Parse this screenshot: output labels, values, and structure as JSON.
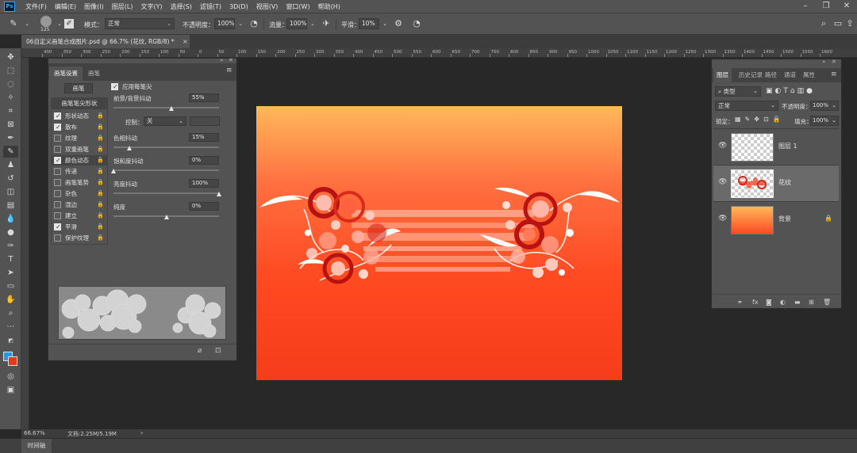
{
  "menubar": {
    "logo": "Ps",
    "items": [
      "文件(F)",
      "编辑(E)",
      "图像(I)",
      "图层(L)",
      "文字(Y)",
      "选择(S)",
      "滤镜(T)",
      "3D(D)",
      "视图(V)",
      "窗口(W)",
      "帮助(H)"
    ]
  },
  "options": {
    "brush_size": "125",
    "mode_label": "模式：",
    "mode_value": "正常",
    "opacity_label": "不透明度：",
    "opacity_value": "100%",
    "flow_label": "流量：",
    "flow_value": "100%",
    "smooth_label": "平滑：",
    "smooth_value": "10%"
  },
  "document": {
    "tab_title": "06自定义画笔合成图片.psd @ 66.7% (花纹, RGB/8) *",
    "close": "×"
  },
  "ruler_ticks": [
    "400",
    "350",
    "300",
    "250",
    "200",
    "150",
    "100",
    "50",
    "0",
    "50",
    "100",
    "150",
    "200",
    "250",
    "300",
    "350",
    "400",
    "450",
    "500",
    "550",
    "600",
    "650",
    "700",
    "750",
    "800",
    "850",
    "900",
    "950",
    "1000",
    "1050",
    "1100",
    "1150",
    "1200",
    "1250",
    "1300",
    "1350",
    "1400",
    "1450",
    "1500",
    "1550",
    "1600"
  ],
  "brush_panel": {
    "tabs": [
      "画笔设置",
      "画笔"
    ],
    "brush_button": "画笔",
    "tip_shape": "画笔笔尖形状",
    "options": [
      {
        "label": "形状动态",
        "checked": true
      },
      {
        "label": "散布",
        "checked": true
      },
      {
        "label": "纹理",
        "checked": false
      },
      {
        "label": "双重画笔",
        "checked": false
      },
      {
        "label": "颜色动态",
        "checked": true
      },
      {
        "label": "传递",
        "checked": false
      },
      {
        "label": "画笔笔势",
        "checked": false
      },
      {
        "label": "杂色",
        "checked": false
      },
      {
        "label": "湿边",
        "checked": false
      },
      {
        "label": "建立",
        "checked": false
      },
      {
        "label": "平滑",
        "checked": true
      },
      {
        "label": "保护纹理",
        "checked": false
      }
    ],
    "apply_per_tip": "应用每笔尖",
    "fg_bg_jitter_label": "前景/背景抖动",
    "fg_bg_jitter_value": "55%",
    "control_label": "控制：",
    "control_value": "关",
    "hue_jitter_label": "色相抖动",
    "hue_jitter_value": "15%",
    "sat_jitter_label": "饱和度抖动",
    "sat_jitter_value": "0%",
    "bright_jitter_label": "亮度抖动",
    "bright_jitter_value": "100%",
    "purity_label": "纯度",
    "purity_value": "0%",
    "sliders": {
      "fg_bg": 0.55,
      "hue": 0.15,
      "sat": 0.0,
      "bright": 1.0,
      "purity": 0.5
    }
  },
  "layers_panel": {
    "tabs": [
      "图层",
      "历史记录",
      "路径",
      "通道",
      "属性"
    ],
    "filter_label": "类型",
    "blend_mode": "正常",
    "opacity_label": "不透明度：",
    "opacity_value": "100%",
    "lock_label": "锁定：",
    "fill_label": "填充：",
    "fill_value": "100%",
    "layers": [
      {
        "name": "图层 1",
        "selected": false
      },
      {
        "name": "花纹",
        "selected": true
      },
      {
        "name": "背景",
        "selected": false
      }
    ]
  },
  "status": {
    "zoom": "66.67%",
    "doc": "文档:2.25M/5.19M",
    "arrow": "›"
  },
  "timeline": {
    "label": "时间轴"
  },
  "colors": {
    "foreground": "#1e9be8",
    "background": "#e43a1a"
  }
}
